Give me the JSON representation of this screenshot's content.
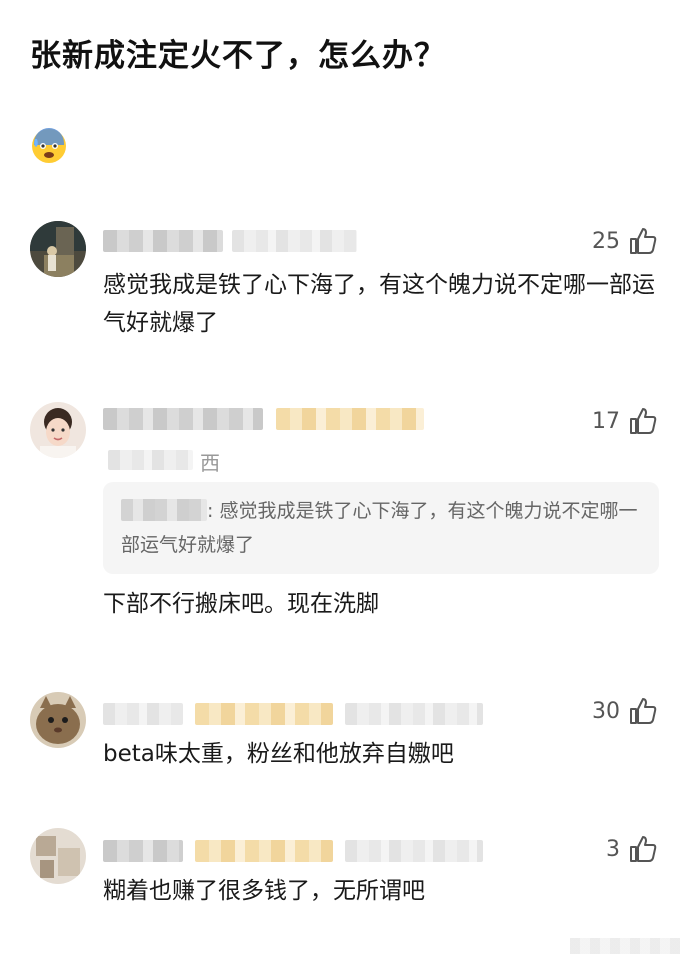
{
  "post": {
    "title": "张新成注定火不了，怎么办？"
  },
  "comments": [
    {
      "likes": "25",
      "text": "感觉我成是铁了心下海了，有这个魄力说不定哪一部运气好就爆了"
    },
    {
      "likes": "17",
      "location": "西",
      "quote_text": "感觉我成是铁了心下海了，有这个魄力说不定哪一部运气好就爆了",
      "text": "下部不行搬床吧。现在洗脚"
    },
    {
      "likes": "30",
      "text": "beta味太重，粉丝和他放弃自嫐吧"
    },
    {
      "likes": "3",
      "text": "糊着也赚了很多钱了，无所谓吧"
    }
  ],
  "icons": {
    "emoji": "anxious-face-icon",
    "like": "thumbs-up-icon"
  }
}
